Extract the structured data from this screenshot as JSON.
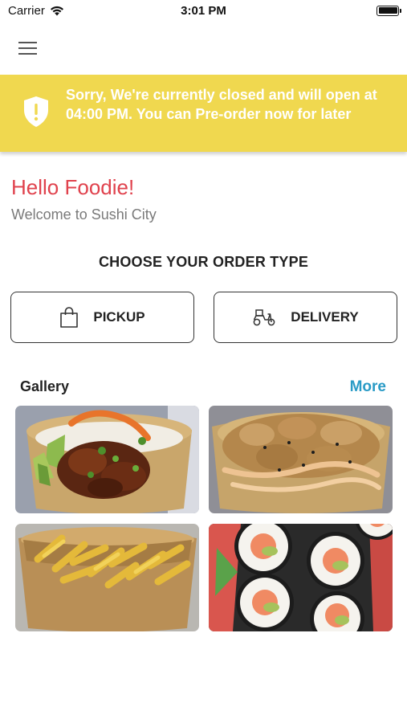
{
  "status_bar": {
    "carrier": "Carrier",
    "time": "3:01 PM"
  },
  "header": {
    "menu_icon": "hamburger-menu-icon"
  },
  "banner": {
    "message": "Sorry, We're currently closed and will open at 04:00 PM. You can Pre-order now for later",
    "icon": "shield-alert-icon",
    "background": "#f0d84f"
  },
  "greeting": {
    "title": "Hello Foodie!",
    "subtitle": "Welcome to Sushi City",
    "accent": "#e0424d"
  },
  "order_type": {
    "heading": "CHOOSE YOUR ORDER TYPE",
    "options": [
      {
        "label": "PICKUP",
        "icon": "shopping-bag-icon"
      },
      {
        "label": "DELIVERY",
        "icon": "scooter-icon"
      }
    ]
  },
  "gallery": {
    "title": "Gallery",
    "more_label": "More",
    "more_color": "#2a9bc6",
    "items": [
      {
        "name": "teriyaki-chicken-bowl-photo"
      },
      {
        "name": "fried-chicken-bowl-photo"
      },
      {
        "name": "fries-photo"
      },
      {
        "name": "sushi-rolls-photo"
      }
    ]
  }
}
